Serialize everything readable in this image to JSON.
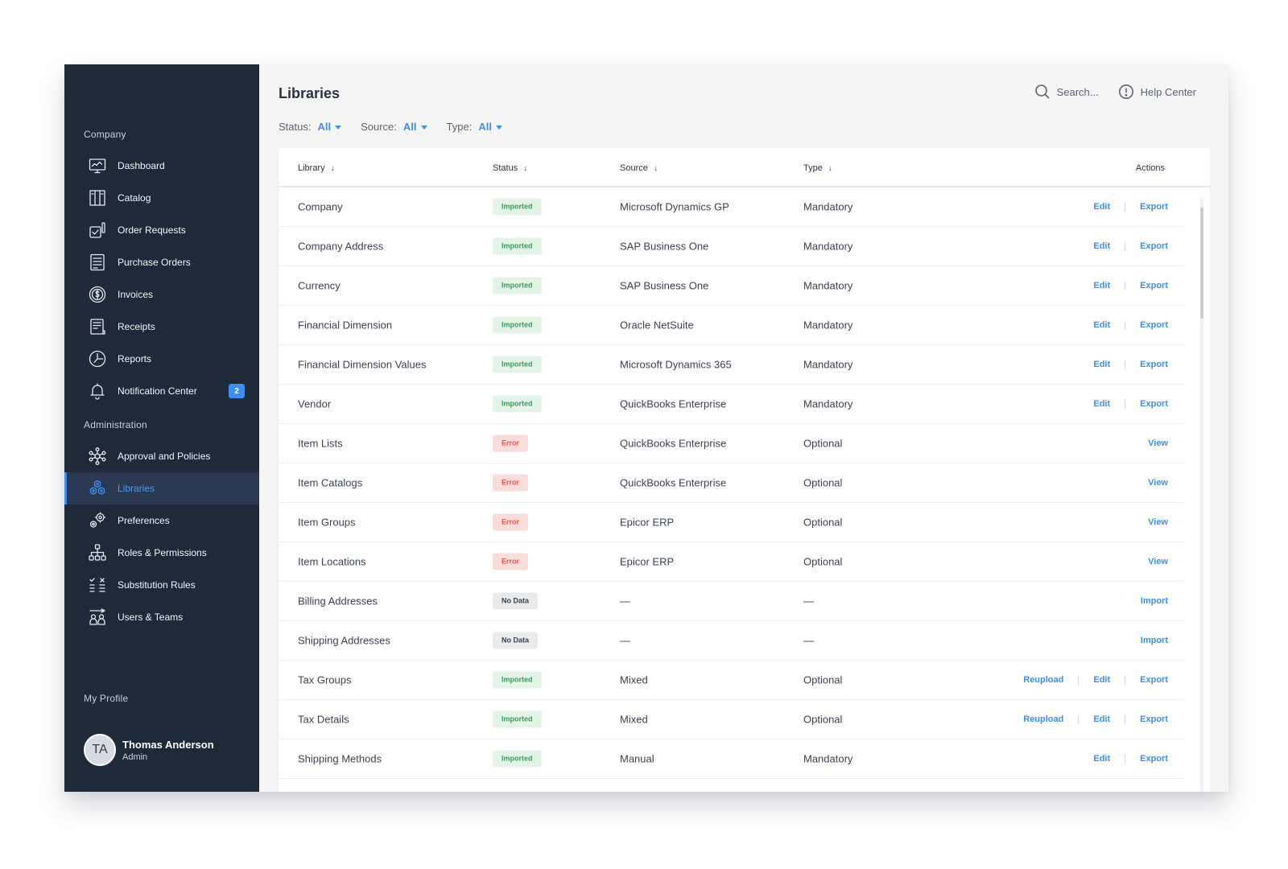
{
  "sidebar": {
    "company_title": "Company",
    "company_items": [
      {
        "label": "Dashboard",
        "icon": "dashboard-icon"
      },
      {
        "label": "Catalog",
        "icon": "catalog-icon"
      },
      {
        "label": "Order Requests",
        "icon": "order-requests-icon"
      },
      {
        "label": "Purchase Orders",
        "icon": "purchase-orders-icon"
      },
      {
        "label": "Invoices",
        "icon": "invoices-icon"
      },
      {
        "label": "Receipts",
        "icon": "receipts-icon"
      },
      {
        "label": "Reports",
        "icon": "reports-icon"
      },
      {
        "label": "Notification Center",
        "icon": "bell-icon",
        "badge": "2"
      }
    ],
    "admin_title": "Administration",
    "admin_items": [
      {
        "label": "Approval and Policies",
        "icon": "approval-icon"
      },
      {
        "label": "Libraries",
        "icon": "libraries-icon",
        "active": true
      },
      {
        "label": "Preferences",
        "icon": "preferences-icon"
      },
      {
        "label": "Roles & Permissions",
        "icon": "roles-icon"
      },
      {
        "label": "Substitution Rules",
        "icon": "substitution-icon"
      },
      {
        "label": "Users & Teams",
        "icon": "users-icon"
      }
    ],
    "profile_title": "My Profile",
    "profile": {
      "initials": "TA",
      "name": "Thomas Anderson",
      "role": "Admin"
    }
  },
  "header": {
    "title": "Libraries",
    "search_label": "Search...",
    "help_label": "Help Center"
  },
  "filters": {
    "status": {
      "label": "Status:",
      "value": "All"
    },
    "source": {
      "label": "Source:",
      "value": "All"
    },
    "type": {
      "label": "Type:",
      "value": "All"
    }
  },
  "table": {
    "columns": {
      "library": "Library",
      "status": "Status",
      "source": "Source",
      "type": "Type",
      "actions": "Actions"
    },
    "rows": [
      {
        "library": "Company",
        "status": "Imported",
        "status_kind": "imported",
        "source": "Microsoft Dynamics GP",
        "type": "Mandatory",
        "actions": [
          "Edit",
          "Export"
        ]
      },
      {
        "library": "Company Address",
        "status": "Imported",
        "status_kind": "imported",
        "source": "SAP Business One",
        "type": "Mandatory",
        "actions": [
          "Edit",
          "Export"
        ]
      },
      {
        "library": "Currency",
        "status": "Imported",
        "status_kind": "imported",
        "source": "SAP Business One",
        "type": "Mandatory",
        "actions": [
          "Edit",
          "Export"
        ]
      },
      {
        "library": "Financial Dimension",
        "status": "Imported",
        "status_kind": "imported",
        "source": "Oracle NetSuite",
        "type": "Mandatory",
        "actions": [
          "Edit",
          "Export"
        ]
      },
      {
        "library": "Financial Dimension Values",
        "status": "Imported",
        "status_kind": "imported",
        "source": "Microsoft Dynamics 365",
        "type": "Mandatory",
        "actions": [
          "Edit",
          "Export"
        ]
      },
      {
        "library": "Vendor",
        "status": "Imported",
        "status_kind": "imported",
        "source": "QuickBooks Enterprise",
        "type": "Mandatory",
        "actions": [
          "Edit",
          "Export"
        ]
      },
      {
        "library": "Item Lists",
        "status": "Error",
        "status_kind": "error",
        "source": "QuickBooks Enterprise",
        "type": "Optional",
        "actions": [
          "View"
        ]
      },
      {
        "library": "Item Catalogs",
        "status": "Error",
        "status_kind": "error",
        "source": "QuickBooks Enterprise",
        "type": "Optional",
        "actions": [
          "View"
        ]
      },
      {
        "library": "Item Groups",
        "status": "Error",
        "status_kind": "error",
        "source": "Epicor ERP",
        "type": "Optional",
        "actions": [
          "View"
        ]
      },
      {
        "library": "Item Locations",
        "status": "Error",
        "status_kind": "error",
        "source": "Epicor ERP",
        "type": "Optional",
        "actions": [
          "View"
        ]
      },
      {
        "library": "Billing Addresses",
        "status": "No Data",
        "status_kind": "nodata",
        "source": "—",
        "type": "—",
        "actions": [
          "Import"
        ]
      },
      {
        "library": "Shipping Addresses",
        "status": "No Data",
        "status_kind": "nodata",
        "source": "—",
        "type": "—",
        "actions": [
          "Import"
        ]
      },
      {
        "library": "Tax Groups",
        "status": "Imported",
        "status_kind": "imported",
        "source": "Mixed",
        "type": "Optional",
        "actions": [
          "Reupload",
          "Edit",
          "Export"
        ]
      },
      {
        "library": "Tax Details",
        "status": "Imported",
        "status_kind": "imported",
        "source": "Mixed",
        "type": "Optional",
        "actions": [
          "Reupload",
          "Edit",
          "Export"
        ]
      },
      {
        "library": "Shipping Methods",
        "status": "Imported",
        "status_kind": "imported",
        "source": "Manual",
        "type": "Mandatory",
        "actions": [
          "Edit",
          "Export"
        ]
      }
    ]
  },
  "colors": {
    "sidebar_bg": "#1e2939",
    "accent": "#3d8ef0",
    "imported": "#3f9a5e",
    "error": "#e1574c"
  }
}
